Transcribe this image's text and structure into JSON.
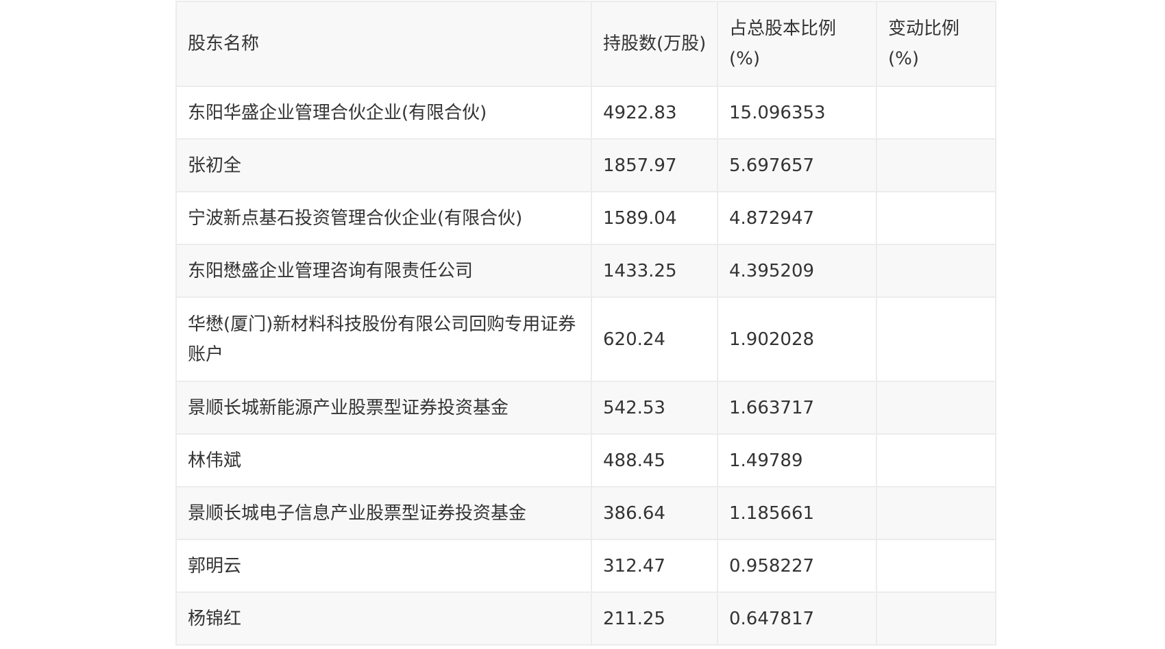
{
  "table": {
    "headers": [
      "股东名称",
      "持股数(万股)",
      "占总股本比例(%)",
      "变动比例(%)"
    ],
    "rows": [
      {
        "name": "东阳华盛企业管理合伙企业(有限合伙)",
        "shares": "4922.83",
        "ratio": "15.096353",
        "change": ""
      },
      {
        "name": "张初全",
        "shares": "1857.97",
        "ratio": "5.697657",
        "change": ""
      },
      {
        "name": "宁波新点基石投资管理合伙企业(有限合伙)",
        "shares": "1589.04",
        "ratio": "4.872947",
        "change": ""
      },
      {
        "name": "东阳懋盛企业管理咨询有限责任公司",
        "shares": "1433.25",
        "ratio": "4.395209",
        "change": ""
      },
      {
        "name": "华懋(厦门)新材料科技股份有限公司回购专用证券账户",
        "shares": "620.24",
        "ratio": "1.902028",
        "change": ""
      },
      {
        "name": "景顺长城新能源产业股票型证券投资基金",
        "shares": "542.53",
        "ratio": "1.663717",
        "change": ""
      },
      {
        "name": "林伟斌",
        "shares": "488.45",
        "ratio": "1.49789",
        "change": ""
      },
      {
        "name": "景顺长城电子信息产业股票型证券投资基金",
        "shares": "386.64",
        "ratio": "1.185661",
        "change": ""
      },
      {
        "name": "郭明云",
        "shares": "312.47",
        "ratio": "0.958227",
        "change": ""
      },
      {
        "name": "杨锦红",
        "shares": "211.25",
        "ratio": "0.647817",
        "change": ""
      }
    ]
  }
}
